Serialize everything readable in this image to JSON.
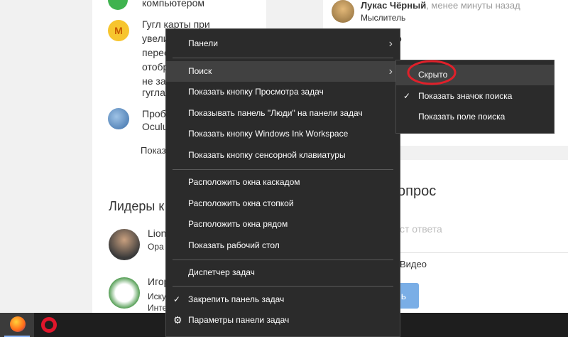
{
  "page": {
    "left_top_text": "компьютером",
    "question_lines": [
      "Гугл карты при",
      "увели",
      "перес",
      "отобр",
      "не за",
      "гугла."
    ],
    "second_item": [
      "Пробл",
      "Oculu"
    ],
    "show_link": "Показ",
    "leaders_title": "Лидеры к",
    "leader1": {
      "name": "Lion",
      "sub": "Ора"
    },
    "leader2": {
      "name": "Игор",
      "sub1": "Иску",
      "sub2": "Интел"
    },
    "comment": {
      "author": "Лукас Чёрный",
      "time": ", менее минуты назад",
      "role": "Мыслитель",
      "side_text": "о"
    },
    "ask_title": "опрос",
    "ask_placeholder": "ст ответа",
    "ask_option": "Видео",
    "ask_button": "ь",
    "avatar_m": "M"
  },
  "context_menu": {
    "items": [
      {
        "label": "Панели"
      },
      {
        "label": "Поиск"
      },
      {
        "label": "Показать кнопку Просмотра задач"
      },
      {
        "label": "Показывать панель \"Люди\" на панели задач"
      },
      {
        "label": "Показать кнопку Windows Ink Workspace"
      },
      {
        "label": "Показать кнопку сенсорной клавиатуры"
      },
      {
        "label": "Расположить окна каскадом"
      },
      {
        "label": "Расположить окна стопкой"
      },
      {
        "label": "Расположить окна рядом"
      },
      {
        "label": "Показать рабочий стол"
      },
      {
        "label": "Диспетчер задач"
      },
      {
        "label": "Закрепить панель задач"
      },
      {
        "label": "Параметры панели задач"
      }
    ],
    "arrow_glyph": "›",
    "check_glyph": "✓",
    "gear_glyph": "⚙"
  },
  "submenu": {
    "items": [
      {
        "label": "Скрыто"
      },
      {
        "label": "Показать значок поиска"
      },
      {
        "label": "Показать поле поиска"
      }
    ]
  },
  "colors": {
    "highlight_circle": "#e0202a",
    "menu_bg": "#2b2b2b",
    "menu_hover": "#414141"
  }
}
